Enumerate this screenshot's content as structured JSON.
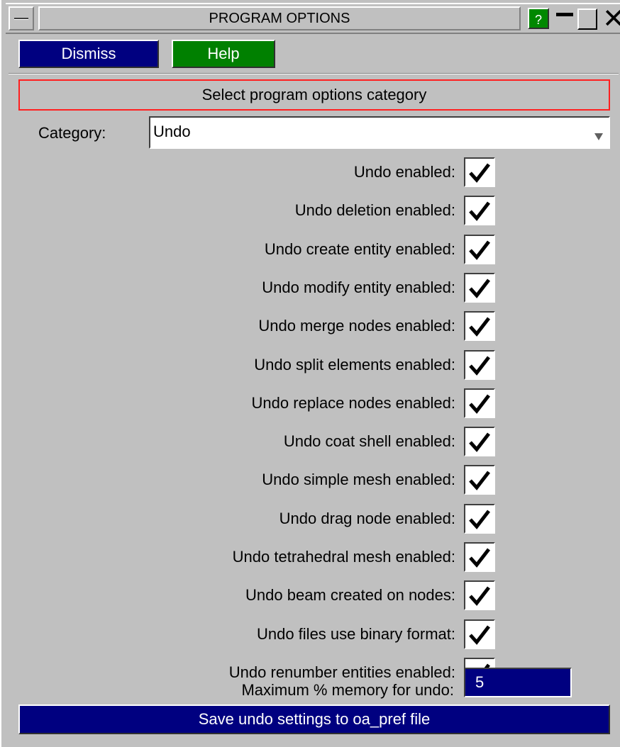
{
  "window": {
    "title": "PROGRAM OPTIONS",
    "help_glyph": "?"
  },
  "toolbar": {
    "dismiss_label": "Dismiss",
    "help_label": "Help"
  },
  "header": {
    "text": "Select program options category"
  },
  "category": {
    "label": "Category:",
    "value": "Undo"
  },
  "options": [
    {
      "label": "Undo enabled:",
      "checked": true
    },
    {
      "label": "Undo deletion enabled:",
      "checked": true
    },
    {
      "label": "Undo create entity enabled:",
      "checked": true
    },
    {
      "label": "Undo modify entity enabled:",
      "checked": true
    },
    {
      "label": "Undo merge nodes enabled:",
      "checked": true
    },
    {
      "label": "Undo split elements enabled:",
      "checked": true
    },
    {
      "label": "Undo replace nodes enabled:",
      "checked": true
    },
    {
      "label": "Undo coat shell enabled:",
      "checked": true
    },
    {
      "label": "Undo simple mesh enabled:",
      "checked": true
    },
    {
      "label": "Undo drag node enabled:",
      "checked": true
    },
    {
      "label": "Undo tetrahedral mesh enabled:",
      "checked": true
    },
    {
      "label": "Undo beam created on nodes:",
      "checked": true
    },
    {
      "label": "Undo files use binary format:",
      "checked": true
    },
    {
      "label": "Undo renumber entities enabled:",
      "checked": true
    }
  ],
  "memory": {
    "label": "Maximum % memory for undo:",
    "value": "5"
  },
  "save": {
    "label": "Save undo settings to oa_pref file"
  },
  "colors": {
    "panel_bg": "#c0c0c0",
    "dismiss_bg": "#000080",
    "help_bg": "#008000",
    "header_border": "#ff2020"
  }
}
